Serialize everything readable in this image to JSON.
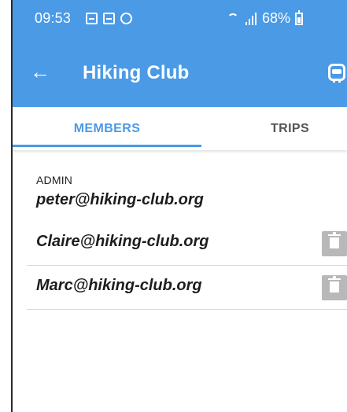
{
  "status_bar": {
    "time": "09:53",
    "battery_text": "68%",
    "icons": [
      "calendar-icon",
      "calendar-icon",
      "sync-icon",
      "wifi-icon",
      "signal-icon",
      "battery-icon"
    ]
  },
  "app_bar": {
    "back_icon": "←",
    "title": "Hiking Club",
    "right_icon": "bus-icon"
  },
  "tabs": [
    {
      "label": "MEMBERS",
      "selected": true
    },
    {
      "label": "TRIPS",
      "selected": false
    }
  ],
  "members": {
    "admin_label": "ADMIN",
    "admin_email": "peter@hiking-club.org",
    "rows": [
      {
        "email": "Claire@hiking-club.org",
        "delete_icon": "trash-icon"
      },
      {
        "email": "Marc@hiking-club.org",
        "delete_icon": "trash-icon"
      }
    ]
  },
  "colors": {
    "accent": "#4a9ae6",
    "text": "#1d1d1d",
    "divider": "#d9d9d9",
    "delete_button": "#b8b8b8"
  }
}
